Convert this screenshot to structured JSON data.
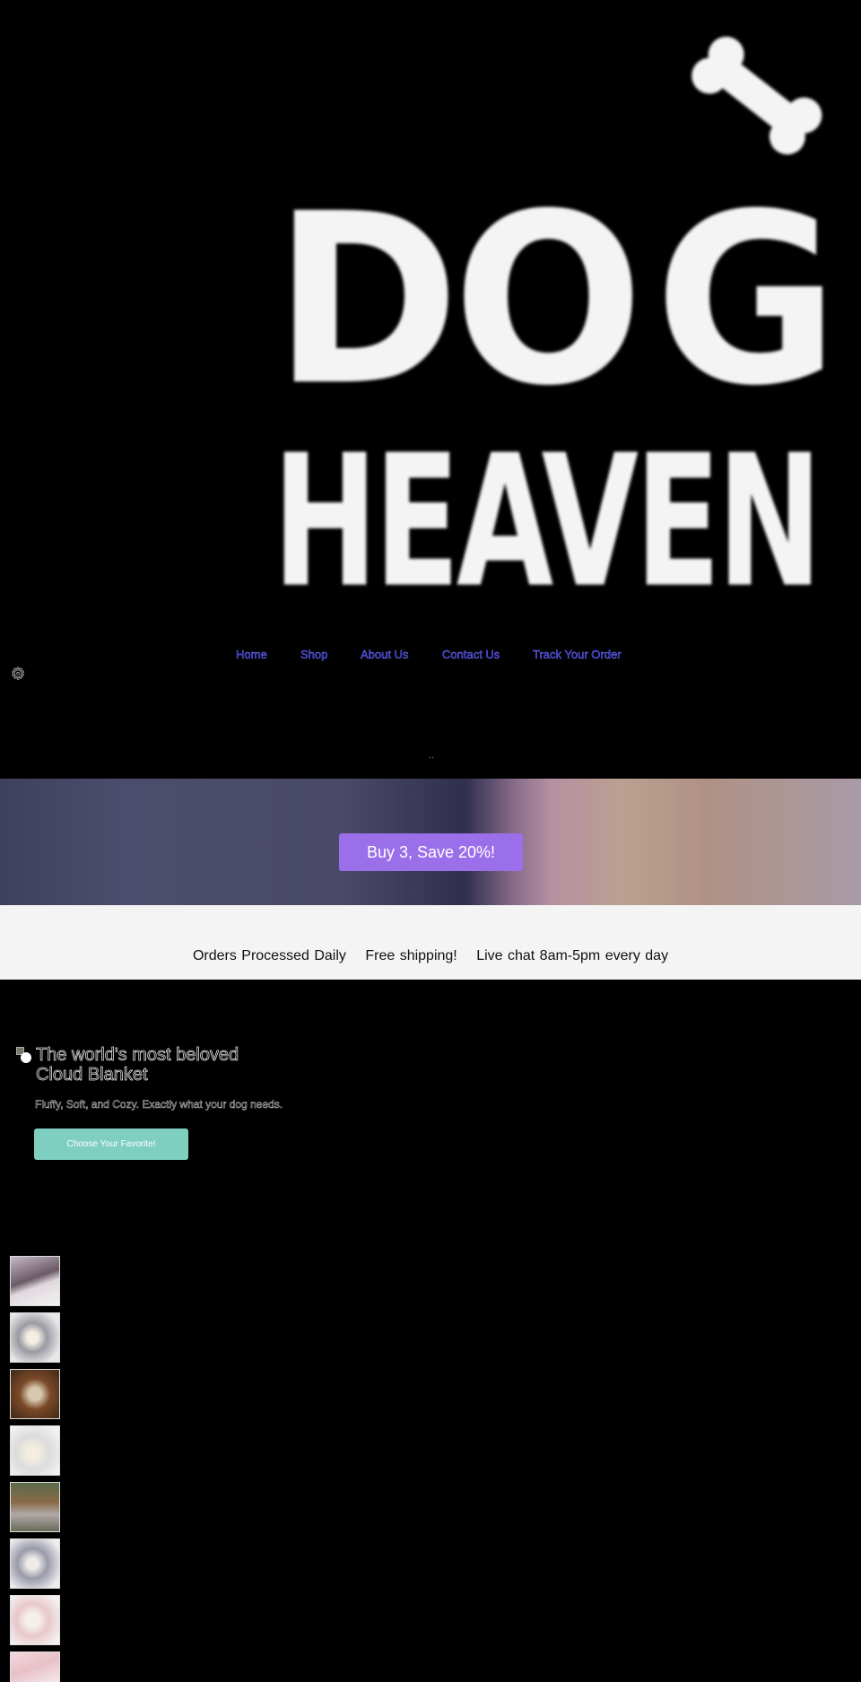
{
  "logo": {
    "line1": "DOG",
    "line2": "HEAVEN",
    "icon": "bone-icon"
  },
  "nav": {
    "items": [
      "Home",
      "Shop",
      "About Us",
      "Contact Us",
      "Track Your Order"
    ],
    "link_color": "#1b1bc0"
  },
  "account_icon": "gear-icon",
  "dots": "..",
  "banner": {
    "button": "Buy 3, Save 20%!",
    "button_color": "#9c6fea"
  },
  "features": [
    "Orders Processed Daily",
    "Free shipping!",
    "Live chat 8am-5pm every day"
  ],
  "hero": {
    "title": "The world's most beloved Cloud Blanket",
    "subtitle": "Fluffy, Soft, and Cozy. Exactly what your dog needs.",
    "button": "Choose Your Favorite!",
    "button_color": "#7ecfc0"
  },
  "thumbnails": [
    {
      "alt": "pink dotted blanket"
    },
    {
      "alt": "grey blanket"
    },
    {
      "alt": "dog on blanket"
    },
    {
      "alt": "white blanket"
    },
    {
      "alt": "dog sleeping"
    },
    {
      "alt": "grey rolled blanket"
    },
    {
      "alt": "pink blanket"
    },
    {
      "alt": "pink pattern blanket"
    }
  ]
}
